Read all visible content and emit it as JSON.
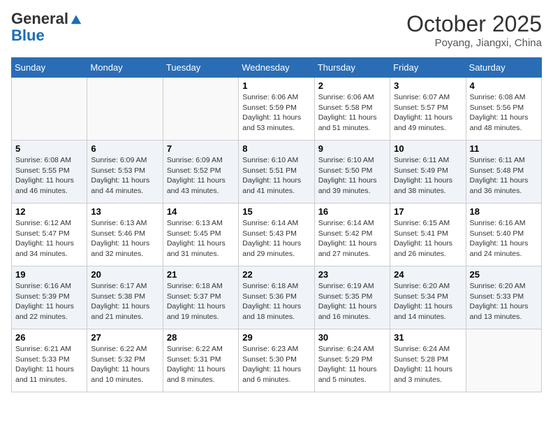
{
  "logo": {
    "general": "General",
    "blue": "Blue"
  },
  "header": {
    "month": "October 2025",
    "location": "Poyang, Jiangxi, China"
  },
  "weekdays": [
    "Sunday",
    "Monday",
    "Tuesday",
    "Wednesday",
    "Thursday",
    "Friday",
    "Saturday"
  ],
  "weeks": [
    [
      {
        "day": "",
        "sunrise": "",
        "sunset": "",
        "daylight": ""
      },
      {
        "day": "",
        "sunrise": "",
        "sunset": "",
        "daylight": ""
      },
      {
        "day": "",
        "sunrise": "",
        "sunset": "",
        "daylight": ""
      },
      {
        "day": "1",
        "sunrise": "Sunrise: 6:06 AM",
        "sunset": "Sunset: 5:59 PM",
        "daylight": "Daylight: 11 hours and 53 minutes."
      },
      {
        "day": "2",
        "sunrise": "Sunrise: 6:06 AM",
        "sunset": "Sunset: 5:58 PM",
        "daylight": "Daylight: 11 hours and 51 minutes."
      },
      {
        "day": "3",
        "sunrise": "Sunrise: 6:07 AM",
        "sunset": "Sunset: 5:57 PM",
        "daylight": "Daylight: 11 hours and 49 minutes."
      },
      {
        "day": "4",
        "sunrise": "Sunrise: 6:08 AM",
        "sunset": "Sunset: 5:56 PM",
        "daylight": "Daylight: 11 hours and 48 minutes."
      }
    ],
    [
      {
        "day": "5",
        "sunrise": "Sunrise: 6:08 AM",
        "sunset": "Sunset: 5:55 PM",
        "daylight": "Daylight: 11 hours and 46 minutes."
      },
      {
        "day": "6",
        "sunrise": "Sunrise: 6:09 AM",
        "sunset": "Sunset: 5:53 PM",
        "daylight": "Daylight: 11 hours and 44 minutes."
      },
      {
        "day": "7",
        "sunrise": "Sunrise: 6:09 AM",
        "sunset": "Sunset: 5:52 PM",
        "daylight": "Daylight: 11 hours and 43 minutes."
      },
      {
        "day": "8",
        "sunrise": "Sunrise: 6:10 AM",
        "sunset": "Sunset: 5:51 PM",
        "daylight": "Daylight: 11 hours and 41 minutes."
      },
      {
        "day": "9",
        "sunrise": "Sunrise: 6:10 AM",
        "sunset": "Sunset: 5:50 PM",
        "daylight": "Daylight: 11 hours and 39 minutes."
      },
      {
        "day": "10",
        "sunrise": "Sunrise: 6:11 AM",
        "sunset": "Sunset: 5:49 PM",
        "daylight": "Daylight: 11 hours and 38 minutes."
      },
      {
        "day": "11",
        "sunrise": "Sunrise: 6:11 AM",
        "sunset": "Sunset: 5:48 PM",
        "daylight": "Daylight: 11 hours and 36 minutes."
      }
    ],
    [
      {
        "day": "12",
        "sunrise": "Sunrise: 6:12 AM",
        "sunset": "Sunset: 5:47 PM",
        "daylight": "Daylight: 11 hours and 34 minutes."
      },
      {
        "day": "13",
        "sunrise": "Sunrise: 6:13 AM",
        "sunset": "Sunset: 5:46 PM",
        "daylight": "Daylight: 11 hours and 32 minutes."
      },
      {
        "day": "14",
        "sunrise": "Sunrise: 6:13 AM",
        "sunset": "Sunset: 5:45 PM",
        "daylight": "Daylight: 11 hours and 31 minutes."
      },
      {
        "day": "15",
        "sunrise": "Sunrise: 6:14 AM",
        "sunset": "Sunset: 5:43 PM",
        "daylight": "Daylight: 11 hours and 29 minutes."
      },
      {
        "day": "16",
        "sunrise": "Sunrise: 6:14 AM",
        "sunset": "Sunset: 5:42 PM",
        "daylight": "Daylight: 11 hours and 27 minutes."
      },
      {
        "day": "17",
        "sunrise": "Sunrise: 6:15 AM",
        "sunset": "Sunset: 5:41 PM",
        "daylight": "Daylight: 11 hours and 26 minutes."
      },
      {
        "day": "18",
        "sunrise": "Sunrise: 6:16 AM",
        "sunset": "Sunset: 5:40 PM",
        "daylight": "Daylight: 11 hours and 24 minutes."
      }
    ],
    [
      {
        "day": "19",
        "sunrise": "Sunrise: 6:16 AM",
        "sunset": "Sunset: 5:39 PM",
        "daylight": "Daylight: 11 hours and 22 minutes."
      },
      {
        "day": "20",
        "sunrise": "Sunrise: 6:17 AM",
        "sunset": "Sunset: 5:38 PM",
        "daylight": "Daylight: 11 hours and 21 minutes."
      },
      {
        "day": "21",
        "sunrise": "Sunrise: 6:18 AM",
        "sunset": "Sunset: 5:37 PM",
        "daylight": "Daylight: 11 hours and 19 minutes."
      },
      {
        "day": "22",
        "sunrise": "Sunrise: 6:18 AM",
        "sunset": "Sunset: 5:36 PM",
        "daylight": "Daylight: 11 hours and 18 minutes."
      },
      {
        "day": "23",
        "sunrise": "Sunrise: 6:19 AM",
        "sunset": "Sunset: 5:35 PM",
        "daylight": "Daylight: 11 hours and 16 minutes."
      },
      {
        "day": "24",
        "sunrise": "Sunrise: 6:20 AM",
        "sunset": "Sunset: 5:34 PM",
        "daylight": "Daylight: 11 hours and 14 minutes."
      },
      {
        "day": "25",
        "sunrise": "Sunrise: 6:20 AM",
        "sunset": "Sunset: 5:33 PM",
        "daylight": "Daylight: 11 hours and 13 minutes."
      }
    ],
    [
      {
        "day": "26",
        "sunrise": "Sunrise: 6:21 AM",
        "sunset": "Sunset: 5:33 PM",
        "daylight": "Daylight: 11 hours and 11 minutes."
      },
      {
        "day": "27",
        "sunrise": "Sunrise: 6:22 AM",
        "sunset": "Sunset: 5:32 PM",
        "daylight": "Daylight: 11 hours and 10 minutes."
      },
      {
        "day": "28",
        "sunrise": "Sunrise: 6:22 AM",
        "sunset": "Sunset: 5:31 PM",
        "daylight": "Daylight: 11 hours and 8 minutes."
      },
      {
        "day": "29",
        "sunrise": "Sunrise: 6:23 AM",
        "sunset": "Sunset: 5:30 PM",
        "daylight": "Daylight: 11 hours and 6 minutes."
      },
      {
        "day": "30",
        "sunrise": "Sunrise: 6:24 AM",
        "sunset": "Sunset: 5:29 PM",
        "daylight": "Daylight: 11 hours and 5 minutes."
      },
      {
        "day": "31",
        "sunrise": "Sunrise: 6:24 AM",
        "sunset": "Sunset: 5:28 PM",
        "daylight": "Daylight: 11 hours and 3 minutes."
      },
      {
        "day": "",
        "sunrise": "",
        "sunset": "",
        "daylight": ""
      }
    ]
  ]
}
